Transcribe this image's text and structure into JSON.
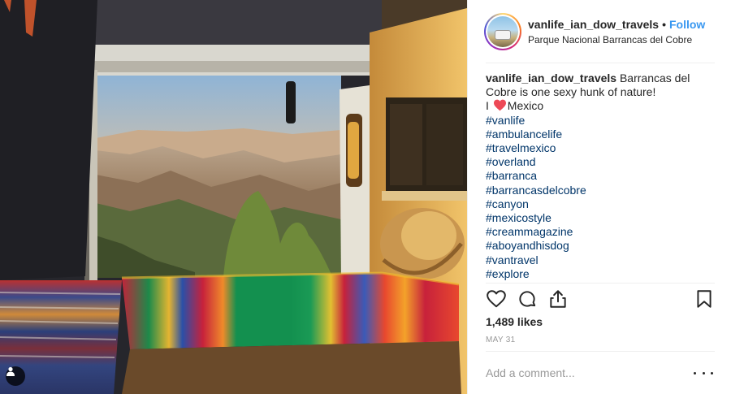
{
  "post": {
    "username": "vanlife_ian_dow_travels",
    "follow_label": "Follow",
    "separator": "•",
    "location": "Parque Nacional Barrancas del Cobre",
    "caption": {
      "text_line1": "Barrancas del Cobre is one sexy hunk of nature!",
      "i_prefix": "I ",
      "heart_icon": "heart-emoji",
      "country": "Mexico",
      "hashtags": [
        "#vanlife",
        "#ambulancelife",
        "#travelmexico",
        "#overland",
        "#barranca",
        "#barrancasdelcobre",
        "#canyon",
        "#mexicostyle",
        "#creammagazine",
        "#aboyandhisdog",
        "#vantravel",
        "#explore"
      ]
    },
    "likes": "1,489 likes",
    "date": "MAY 31",
    "comment_placeholder": "Add a comment..."
  },
  "icons": {
    "like": "heart-outline-icon",
    "comment": "comment-bubble-icon",
    "share": "share-icon",
    "save": "bookmark-icon",
    "more": "more-options-icon",
    "tagged": "user-tag-icon"
  },
  "colors": {
    "link_blue": "#3897f0",
    "hashtag": "#003569",
    "text": "#262626",
    "muted": "#999999",
    "divider": "#efefef",
    "heart_red": "#ed4956"
  }
}
